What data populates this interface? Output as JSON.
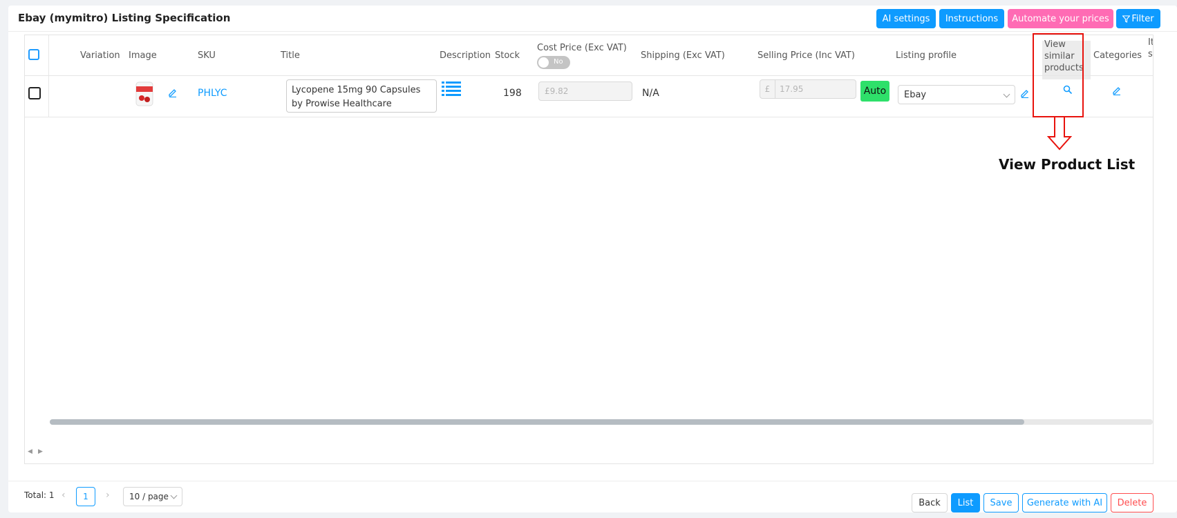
{
  "header": {
    "title": "Ebay (mymitro) Listing Specification",
    "buttons": {
      "ai_settings": "AI settings",
      "instructions": "Instructions",
      "automate": "Automate your prices",
      "filter": "Filter"
    }
  },
  "table": {
    "columns": {
      "variation": "Variation",
      "image": "Image",
      "sku": "SKU",
      "title": "Title",
      "description": "Description",
      "stock": "Stock",
      "cost_price": "Cost Price (Exc VAT)",
      "cost_toggle": "No",
      "shipping": "Shipping (Exc VAT)",
      "selling_price": "Selling Price (Inc VAT)",
      "listing_profile": "Listing profile",
      "view_similar": "View similar products",
      "categories": "Categories",
      "item_specifics": "Item specifics"
    },
    "row": {
      "sku": "PHLYC",
      "title": "Lycopene 15mg 90 Capsules by Prowise Healthcare",
      "stock": "198",
      "cost_price": "£9.82",
      "shipping": "N/A",
      "currency_symbol": "£",
      "selling_price": "17.95",
      "auto_label": "Auto",
      "listing_profile": "Ebay"
    }
  },
  "annotation": {
    "callout": "View Product List",
    "highlight_color": "#e8120c"
  },
  "footer": {
    "total": "Total: 1",
    "current_page": "1",
    "page_size": "10 / page",
    "buttons": {
      "back": "Back",
      "list": "List",
      "save": "Save",
      "generate": "Generate with AI",
      "delete": "Delete"
    }
  },
  "colors": {
    "accent": "#0e9bff",
    "pink": "#ff6bb4",
    "auto_green": "#2ee06a",
    "danger": "#ff4d4f"
  }
}
